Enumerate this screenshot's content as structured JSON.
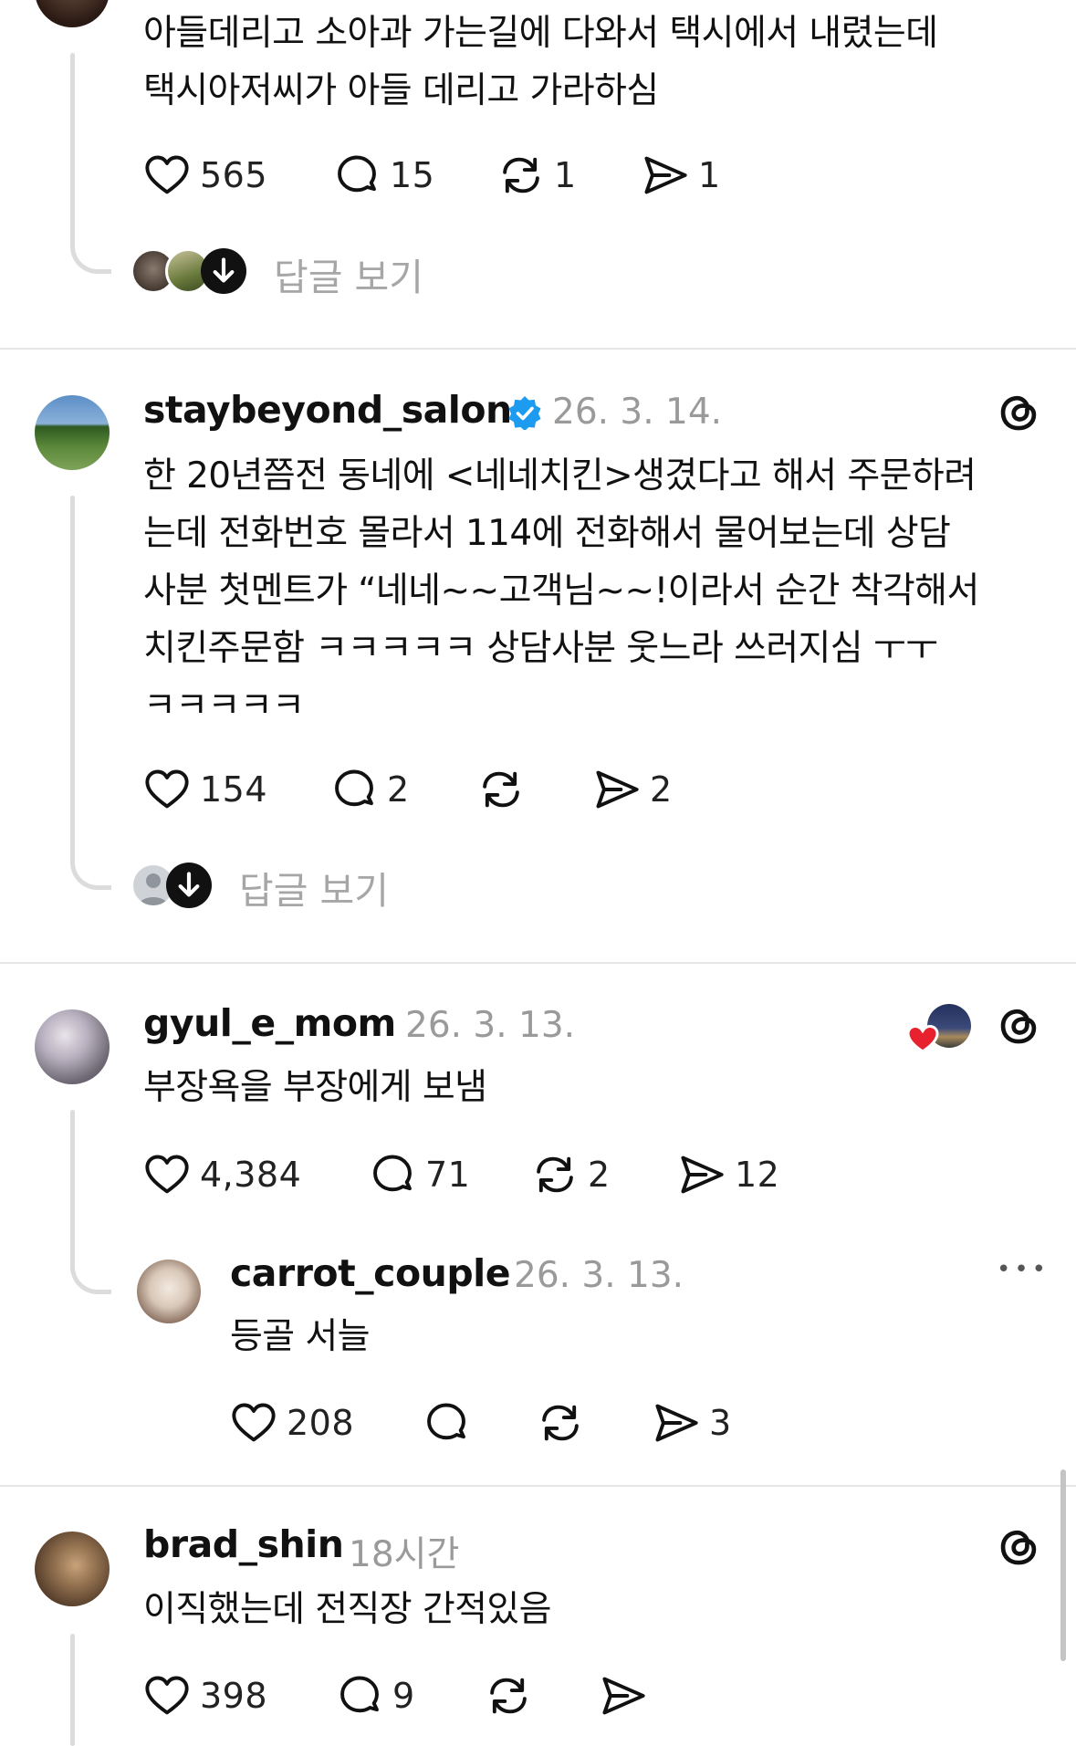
{
  "posts": [
    {
      "username": "",
      "time": "",
      "text_lines": [
        "아들데리고 소아과 가는길에 다와서 택시에서 내렸는데",
        "택시아저씨가 아들 데리고 가라하심"
      ],
      "likes": "565",
      "replies": "15",
      "reposts": "1",
      "shares": "1",
      "view_replies": "답글 보기",
      "icons": {
        "like": "heart-icon",
        "reply": "comment-icon",
        "repost": "repost-icon",
        "share": "send-icon"
      }
    },
    {
      "username": "staybeyond_salon",
      "verified": true,
      "time": "26. 3. 14.",
      "text_lines": [
        "한 20년쯤전 동네에 <네네치킨>생겼다고 해서 주문하려",
        "는데 전화번호 몰라서 114에 전화해서 물어보는데 상담",
        "사분 첫멘트가 “네네~~고객님~~!이라서 순간 착각해서",
        "치킨주문함 ㅋㅋㅋㅋㅋ 상담사분 웃느라 쓰러지심 ㅜㅜ",
        "ㅋㅋㅋㅋㅋ"
      ],
      "likes": "154",
      "replies": "2",
      "reposts": "",
      "shares": "2",
      "view_replies": "답글 보기"
    },
    {
      "username": "gyul_e_mom",
      "time": "26. 3. 13.",
      "text_lines": [
        "부장욕을 부장에게 보냄"
      ],
      "likes": "4,384",
      "replies": "71",
      "reposts": "2",
      "shares": "12",
      "reply": {
        "username": "carrot_couple",
        "time": "26. 3. 13.",
        "text_lines": [
          "등골 서늘"
        ],
        "likes": "208",
        "replies": "",
        "reposts": "",
        "shares": "3",
        "more": "•••"
      }
    },
    {
      "username": "brad_shin",
      "time": "18시간",
      "text_lines": [
        "이직했는데 전직장 간적있음"
      ],
      "likes": "398",
      "replies": "9",
      "reposts": "",
      "shares": ""
    }
  ],
  "colors": {
    "verified": "#1d9bf0",
    "heart_badge": "#e8212e",
    "muted": "#9a9a9a",
    "divider": "#e6e6e6"
  }
}
